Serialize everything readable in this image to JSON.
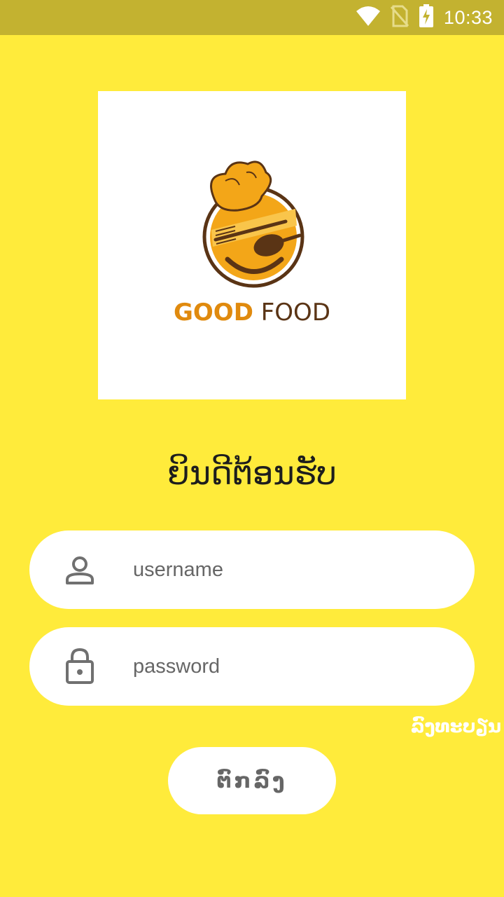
{
  "status_bar": {
    "time": "10:33",
    "icons": [
      "wifi-icon",
      "no-sim-icon",
      "battery-charging-icon"
    ]
  },
  "logo": {
    "text_bold": "GOOD",
    "text_light": "FOOD"
  },
  "welcome": "ຍິນດີຕ້ອນຮັບ",
  "username": {
    "placeholder": "username",
    "icon": "person-icon"
  },
  "password": {
    "placeholder": "password",
    "icon": "lock-icon"
  },
  "register_label": "ລົງທະບຽນ",
  "login_label": "ຕົກລົງ",
  "colors": {
    "background": "#FFEB3B",
    "status_bar": "#C3B230",
    "logo_orange": "#E08A0E",
    "logo_brown": "#5A3415"
  }
}
